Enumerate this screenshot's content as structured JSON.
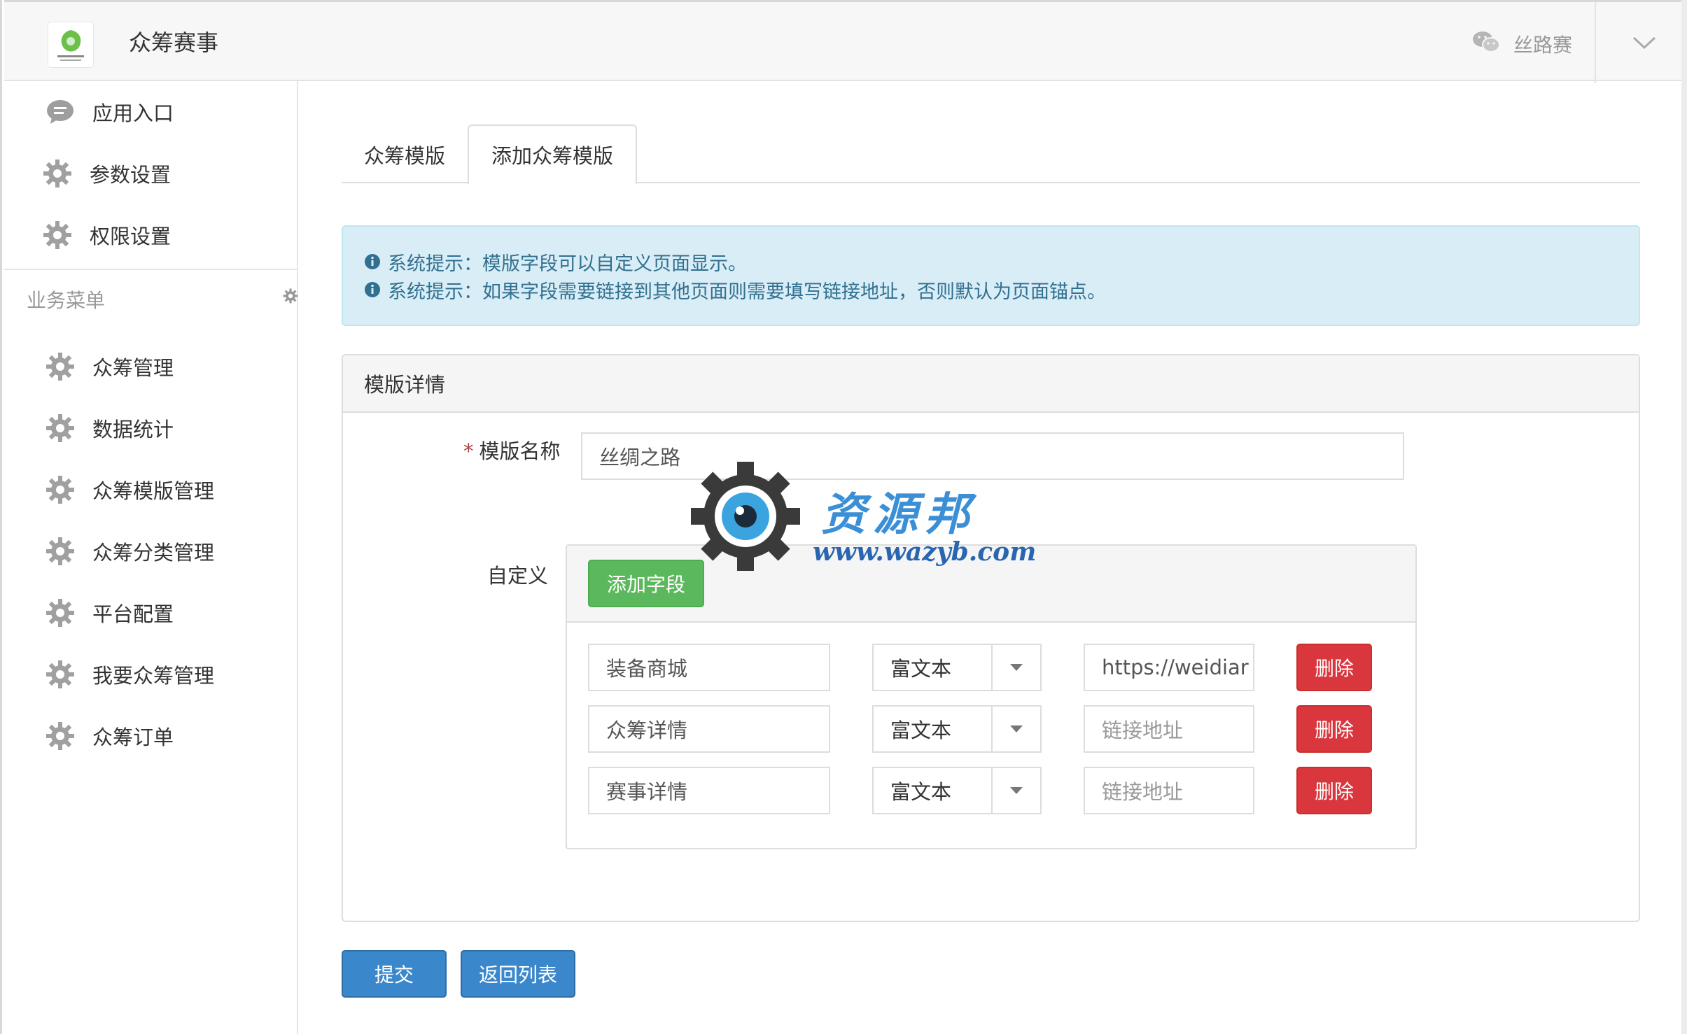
{
  "header": {
    "app_title": "众筹赛事",
    "user_name": "丝路赛"
  },
  "sidebar": {
    "top_items": [
      {
        "label": "应用入口",
        "icon": "chat-bubble-icon"
      },
      {
        "label": "参数设置",
        "icon": "gear-icon"
      },
      {
        "label": "权限设置",
        "icon": "gear-icon"
      }
    ],
    "group_label": "业务菜单",
    "business_items": [
      {
        "label": "众筹管理"
      },
      {
        "label": "数据统计"
      },
      {
        "label": "众筹模版管理"
      },
      {
        "label": "众筹分类管理"
      },
      {
        "label": "平台配置"
      },
      {
        "label": "我要众筹管理"
      },
      {
        "label": "众筹订单"
      }
    ]
  },
  "tabs": [
    {
      "label": "众筹模版",
      "active": false
    },
    {
      "label": "添加众筹模版",
      "active": true
    }
  ],
  "alert": {
    "lines": [
      "系统提示：模版字段可以自定义页面显示。",
      "系统提示：如果字段需要链接到其他页面则需要填写链接地址，否则默认为页面锚点。"
    ]
  },
  "panel": {
    "title": "模版详情",
    "name_label": "模版名称",
    "name_value": "丝绸之路",
    "custom_label": "自定义",
    "add_field_button": "添加字段",
    "fields": [
      {
        "name": "装备商城",
        "type": "富文本",
        "link": "https://weidiar",
        "delete": "删除"
      },
      {
        "name": "众筹详情",
        "type": "富文本",
        "link": "",
        "link_placeholder": "链接地址",
        "delete": "删除"
      },
      {
        "name": "赛事详情",
        "type": "富文本",
        "link": "",
        "link_placeholder": "链接地址",
        "delete": "删除"
      }
    ]
  },
  "actions": {
    "submit": "提交",
    "back": "返回列表"
  },
  "watermark": {
    "title": "资源邦",
    "url": "www.wazyb.com"
  },
  "colors": {
    "primary": "#3a87cc",
    "success": "#5cb85c",
    "danger": "#d9363e",
    "alert_bg": "#d9edf7",
    "alert_text": "#31708f"
  }
}
